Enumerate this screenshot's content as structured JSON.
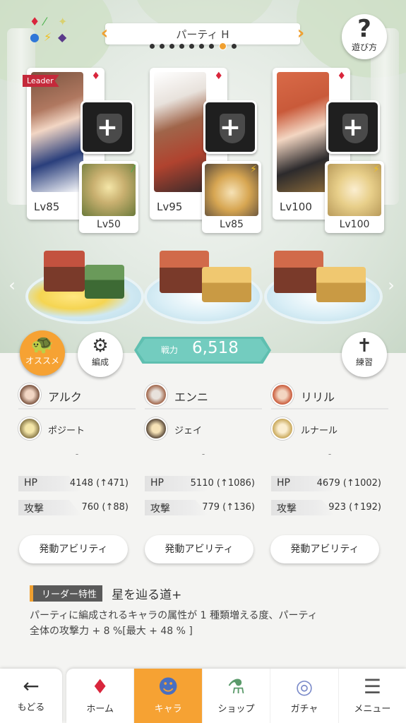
{
  "header": {
    "party_title": "パーティ H",
    "page_dots": [
      false,
      false,
      false,
      false,
      false,
      false,
      false,
      true,
      false
    ],
    "help_label": "遊び方",
    "element_icons": [
      "♦",
      "⁄",
      "✦",
      "●",
      "⚡",
      "◆"
    ]
  },
  "team": [
    {
      "is_leader": true,
      "leader_label": "Leader",
      "level": "Lv85",
      "element": "♦",
      "portrait_color": "#6a4b38",
      "accent": "#2a3f7c",
      "sub": {
        "level": "Lv50",
        "element": "⁄",
        "color": "#c9b070"
      }
    },
    {
      "is_leader": false,
      "level": "Lv95",
      "element": "♦",
      "portrait_color": "#e8e2dc",
      "accent": "#b0432f",
      "sub": {
        "level": "Lv85",
        "element": "⚡",
        "color": "#d7a652"
      }
    },
    {
      "is_leader": false,
      "level": "Lv100",
      "element": "♦",
      "portrait_color": "#c95a3a",
      "accent": "#2c2a2c",
      "sub": {
        "level": "Lv100",
        "element": "⚡",
        "color": "#e8cf8a"
      }
    }
  ],
  "buttons": {
    "recommend_label": "オススメ",
    "formation_label": "編成",
    "practice_label": "練習"
  },
  "power": {
    "label": "戦力",
    "value": "6,518"
  },
  "members": [
    {
      "name": "アルク",
      "sub_name": "ポジート",
      "dash": "-",
      "hp_key": "HP",
      "hp": "4148 (↑471)",
      "atk_key": "攻撃",
      "atk": "760 (↑88)",
      "ability": "発動アビリティ"
    },
    {
      "name": "エンニ",
      "sub_name": "ジェイ",
      "dash": "-",
      "hp_key": "HP",
      "hp": "5110 (↑1086)",
      "atk_key": "攻撃",
      "atk": "779 (↑136)",
      "ability": "発動アビリティ"
    },
    {
      "name": "リリル",
      "sub_name": "ルナール",
      "dash": "-",
      "hp_key": "HP",
      "hp": "4679 (↑1002)",
      "atk_key": "攻撃",
      "atk": "923 (↑192)",
      "ability": "発動アビリティ"
    }
  ],
  "leader_skill": {
    "badge": "リーダー特性",
    "name": "星を辿る道+",
    "line1": "パーティに編成されるキャラの属性が 1 種類増える度、パーティ",
    "line2": "全体の攻撃力 + 8 %[最大 + 48 % ]"
  },
  "nav": {
    "back": "もどる",
    "tabs": [
      "ホーム",
      "キャラ",
      "ショップ",
      "ガチャ",
      "メニュー"
    ],
    "active_index": 1
  },
  "colors": {
    "accent": "#f6a233",
    "power": "#5fbfb0",
    "diamond": "#d9263c"
  }
}
